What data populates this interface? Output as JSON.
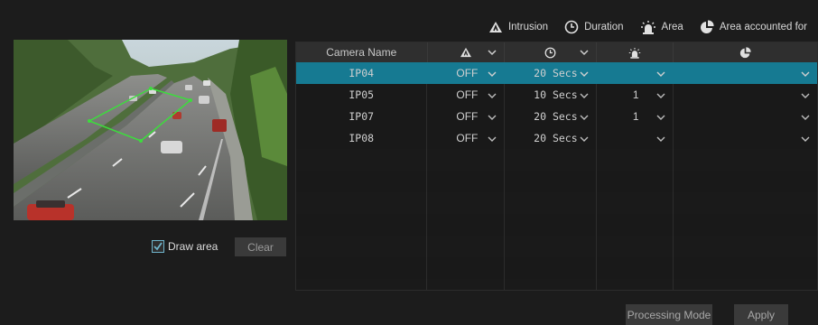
{
  "legend": {
    "intrusion": "Intrusion",
    "duration": "Duration",
    "area": "Area",
    "area_accounted": "Area accounted for"
  },
  "icons": {
    "intrusion": "intrusion-icon",
    "duration": "clock-icon",
    "area": "siren-icon",
    "area_accounted": "pie-icon",
    "dropdown": "chevron-down-icon"
  },
  "colors": {
    "selected_row": "#167a92",
    "region": "#3ddc3d",
    "checkbox_check": "#6fb5cc"
  },
  "draw_area": {
    "label": "Draw area",
    "checked": true
  },
  "clear_label": "Clear",
  "table": {
    "col_camera_name": "Camera Name",
    "rows": [
      {
        "camera": "IP04",
        "intrusion": "OFF",
        "duration": "20 Secs",
        "area": "",
        "accounted": "",
        "selected": true
      },
      {
        "camera": "IP05",
        "intrusion": "OFF",
        "duration": "10 Secs",
        "area": "1",
        "accounted": ""
      },
      {
        "camera": "IP07",
        "intrusion": "OFF",
        "duration": "20 Secs",
        "area": "1",
        "accounted": ""
      },
      {
        "camera": "IP08",
        "intrusion": "OFF",
        "duration": "20 Secs",
        "area": "",
        "accounted": ""
      }
    ]
  },
  "buttons": {
    "processing_mode": "Processing Mode",
    "apply": "Apply"
  }
}
